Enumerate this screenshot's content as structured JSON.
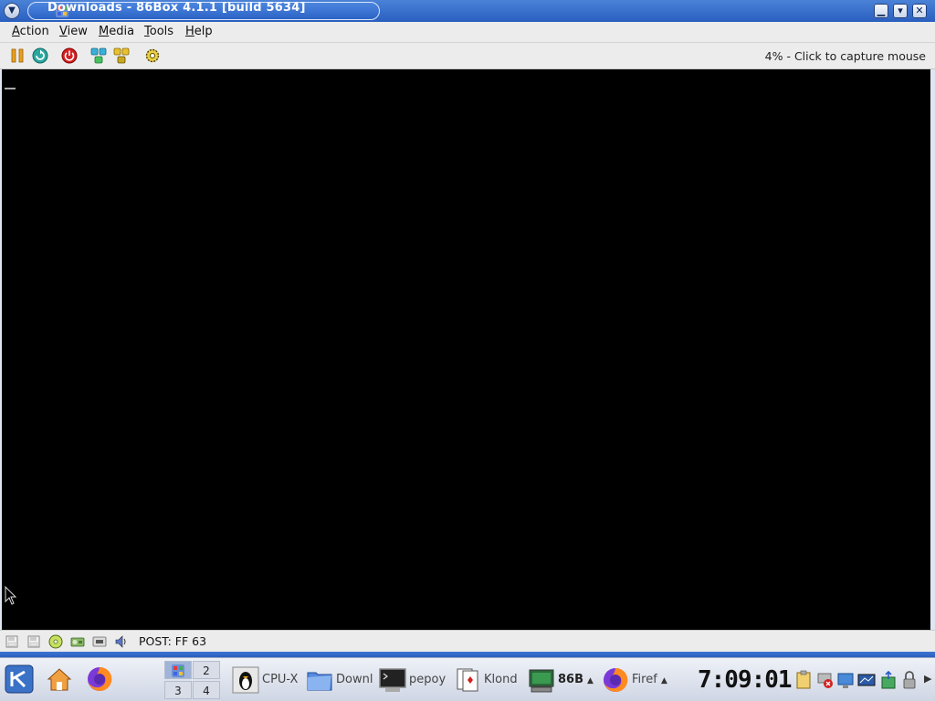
{
  "window": {
    "title": "Downloads - 86Box 4.1.1 [build 5634]",
    "controls": {
      "minimize": "▁",
      "maximize": "▾",
      "close": "✕"
    }
  },
  "menubar": {
    "items": [
      {
        "label": "Action",
        "mnemonic": "A"
      },
      {
        "label": "View",
        "mnemonic": "V"
      },
      {
        "label": "Media",
        "mnemonic": "M"
      },
      {
        "label": "Tools",
        "mnemonic": "T"
      },
      {
        "label": "Help",
        "mnemonic": "H"
      }
    ]
  },
  "toolbar": {
    "tools": [
      "pause-icon",
      "hard-reset-icon",
      "power-icon",
      "ctrl-alt-del-icon",
      "ctrl-alt-esc-icon",
      "settings-icon"
    ],
    "capture_text": "4% - Click to capture mouse"
  },
  "statusbar": {
    "icons": [
      "floppy-icon",
      "floppy-icon",
      "cdrom-icon",
      "hdd-icon",
      "network-icon",
      "sound-icon"
    ],
    "post_code": "POST: FF 63"
  },
  "taskbar": {
    "pager": [
      "1",
      "2",
      "3",
      "4"
    ],
    "tasks": {
      "cpux": "CPU-X",
      "downloads": "Downl",
      "pepoy": "pepoy",
      "klondike": "Klond",
      "box86": "86B",
      "firefox": "Firef"
    },
    "clock": "7:09:01"
  },
  "colors": {
    "title_bar": "#2a5fc0",
    "screen": "#000000",
    "panel": "#ececec"
  }
}
